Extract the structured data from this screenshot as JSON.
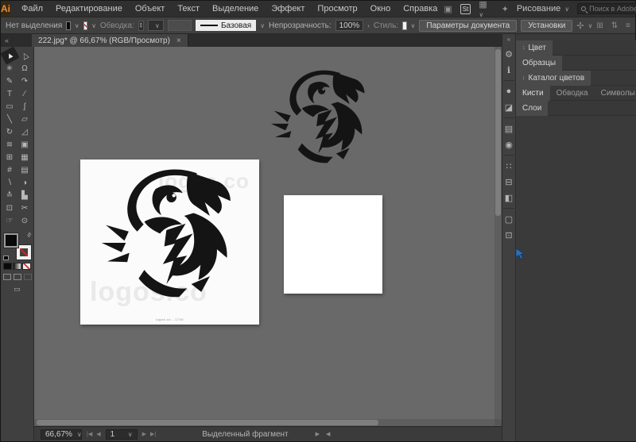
{
  "app": {
    "logo": "Ai"
  },
  "menubar": {
    "items": [
      "Файл",
      "Редактирование",
      "Объект",
      "Текст",
      "Выделение",
      "Эффект",
      "Просмотр",
      "Окно",
      "Справка"
    ],
    "stock_badge": "St",
    "workspace": "Рисование",
    "search_placeholder": "Поиск в Adobe Stock",
    "win_min": "–",
    "win_max": "❐",
    "win_close": "✕"
  },
  "icons": {
    "chevron_down": "∨",
    "chevron_right": "›",
    "menu": "≡",
    "collapse_left": "«",
    "collapse_right": "«",
    "updown": "↕",
    "swap": "⇄",
    "tab_close": "×",
    "step_up": "▲",
    "step_down": "▼",
    "arrange_documents": "▦",
    "share": "✦",
    "app_frame": "▣",
    "touch": "✢"
  },
  "options_bar": {
    "no_selection": "Нет выделения",
    "stroke_label": "Обводка:",
    "stroke_style": "Базовая",
    "opacity_label": "Непрозрачность:",
    "opacity_value": "100%",
    "style_label": "Стиль:",
    "doc_setup_button": "Параметры документа",
    "preferences_button": "Установки",
    "right_icon_a": "⊞",
    "right_icon_b": "⇅",
    "right_icon_c": "≡"
  },
  "tab": {
    "title": "222.jpg* @ 66,67% (RGB/Просмотр)"
  },
  "tools": [
    {
      "name": "selection-tool",
      "glyph": "▲",
      "selected": true
    },
    {
      "name": "direct-selection-tool",
      "glyph": "△"
    },
    {
      "name": "magic-wand-tool",
      "glyph": "✳"
    },
    {
      "name": "lasso-tool",
      "glyph": "Ω"
    },
    {
      "name": "pen-tool",
      "glyph": "✎"
    },
    {
      "name": "curvature-tool",
      "glyph": "↷"
    },
    {
      "name": "type-tool",
      "glyph": "T"
    },
    {
      "name": "line-segment-tool",
      "glyph": "⁄"
    },
    {
      "name": "rectangle-tool",
      "glyph": "▭"
    },
    {
      "name": "paintbrush-tool",
      "glyph": "ʃ"
    },
    {
      "name": "pencil-tool",
      "glyph": "╲"
    },
    {
      "name": "eraser-tool",
      "glyph": "▱"
    },
    {
      "name": "rotate-tool",
      "glyph": "↻"
    },
    {
      "name": "scale-tool",
      "glyph": "◿"
    },
    {
      "name": "width-tool",
      "glyph": "≋"
    },
    {
      "name": "free-transform-tool",
      "glyph": "▣"
    },
    {
      "name": "shape-builder-tool",
      "glyph": "⊞"
    },
    {
      "name": "perspective-grid-tool",
      "glyph": "▦"
    },
    {
      "name": "mesh-tool",
      "glyph": "#"
    },
    {
      "name": "gradient-tool",
      "glyph": "▤"
    },
    {
      "name": "eyedropper-tool",
      "glyph": "∖"
    },
    {
      "name": "blend-tool",
      "glyph": "◑"
    },
    {
      "name": "symbol-sprayer-tool",
      "glyph": "≛"
    },
    {
      "name": "column-graph-tool",
      "glyph": "▙"
    },
    {
      "name": "artboard-tool",
      "glyph": "⊡"
    },
    {
      "name": "slice-tool",
      "glyph": "✂"
    },
    {
      "name": "hand-tool",
      "glyph": "☞"
    },
    {
      "name": "zoom-tool",
      "glyph": "⊙"
    }
  ],
  "dock_icons": [
    {
      "name": "gear-icon",
      "glyph": "⚙"
    },
    {
      "name": "info-icon",
      "glyph": "ℹ"
    },
    {
      "name": "color-panel-icon",
      "glyph": "●"
    },
    {
      "name": "swatches-panel-icon",
      "glyph": "◪"
    },
    {
      "name": "gradient-panel-icon",
      "glyph": "▤"
    },
    {
      "name": "transparency-panel-icon",
      "glyph": "◉"
    },
    {
      "name": "align-panel-icon",
      "glyph": "∷"
    },
    {
      "name": "pathfinder-panel-icon",
      "glyph": "◧"
    },
    {
      "name": "arrange-panel-icon",
      "glyph": "⊟"
    },
    {
      "name": "appearance-panel-icon",
      "glyph": "▢"
    },
    {
      "name": "artboards-panel-icon",
      "glyph": "⊡"
    }
  ],
  "panels": {
    "headers": [
      {
        "label": "Цвет"
      },
      {
        "label": "Образцы"
      },
      {
        "label": "Каталог цветов"
      },
      {
        "tabs": [
          "Кисти",
          "Обводка",
          "Символы"
        ]
      },
      {
        "label": "Слои"
      }
    ]
  },
  "canvas": {
    "watermark_top": "logos.co",
    "watermark_bottom": "logos.co",
    "caption": "logos.co - 1740"
  },
  "statusbar": {
    "zoom": "66,67%",
    "nav_first": "|◀",
    "nav_prev": "◀",
    "artboard": "1",
    "nav_next": "▶",
    "nav_last": "▶|",
    "status": "Выделенный фрагмент",
    "fwd": "▶",
    "back": "◀"
  },
  "colors": {
    "canvas_gray": "#696969",
    "panel_dark": "#3a3a3a",
    "accent_orange": "#ee8b2c",
    "none_red": "#cf2222",
    "artboard_white": "#ffffff",
    "ink_black": "#141414",
    "cursor_blue": "#2e70b8"
  }
}
